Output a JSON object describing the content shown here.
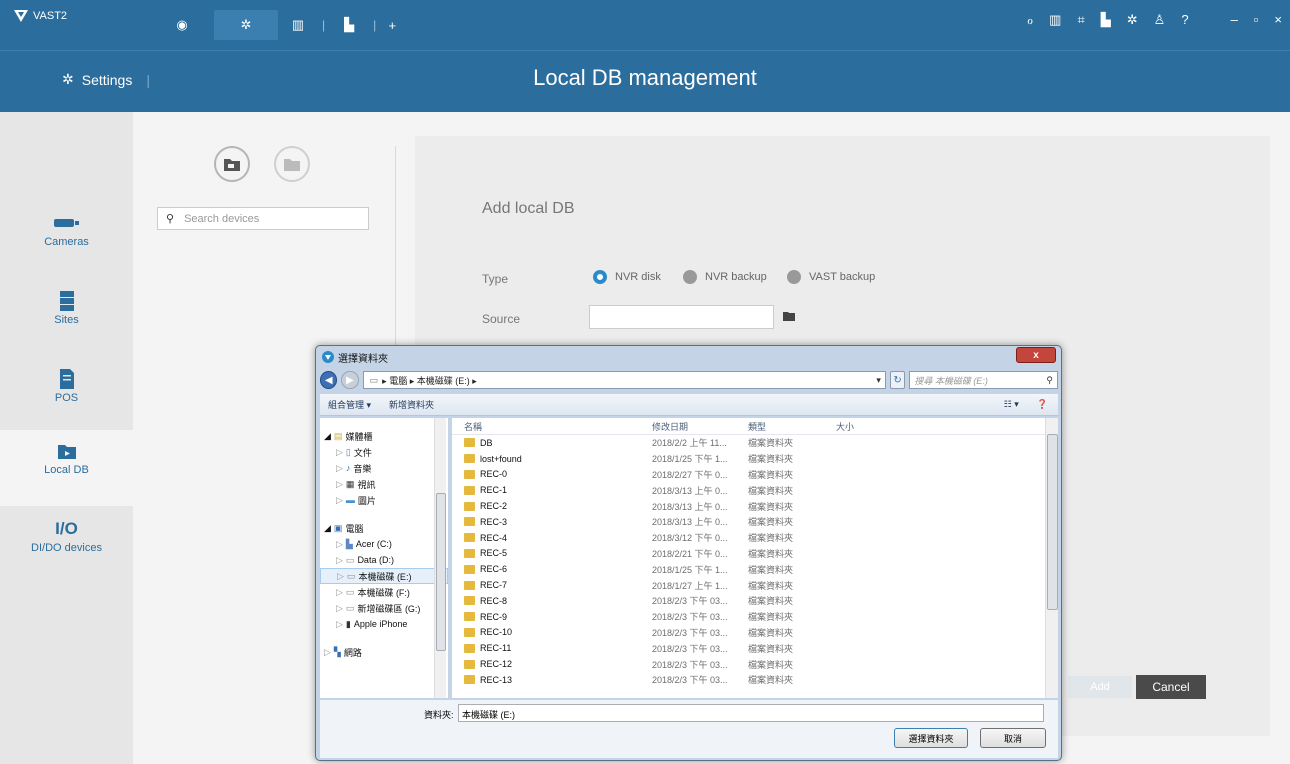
{
  "topbar": {
    "app_name": "VAST2",
    "right_icons": [
      "connect-icon",
      "map-icon",
      "chart-icon",
      "pos-icon",
      "settings-icon",
      "user-icon",
      "help-icon"
    ],
    "help": "?",
    "min": "–",
    "max": "▫",
    "close": "×"
  },
  "header": {
    "settings": "Settings",
    "title": "Local DB management"
  },
  "sidebar": {
    "items": [
      {
        "label": "Cameras"
      },
      {
        "label": "Sites"
      },
      {
        "label": "POS"
      },
      {
        "label": "Local DB"
      },
      {
        "label": "DI/DO devices",
        "icon_text": "I/O"
      }
    ]
  },
  "search": {
    "placeholder": "Search devices"
  },
  "form": {
    "title": "Add local DB",
    "type_label": "Type",
    "source_label": "Source",
    "options": [
      "NVR disk",
      "NVR backup",
      "VAST backup"
    ],
    "add": "Add",
    "cancel": "Cancel"
  },
  "dialog": {
    "title": "選擇資料夾",
    "path": "▸ 電腦 ▸ 本機磁碟 (E:) ▸",
    "search_placeholder": "搜尋 本機磁碟 (E:)",
    "toolbar": {
      "organize": "組合管理 ▾",
      "new_folder": "新增資料夾"
    },
    "tree": [
      {
        "label": "媒體櫃"
      },
      {
        "label": "文件"
      },
      {
        "label": "音樂"
      },
      {
        "label": "視訊"
      },
      {
        "label": "圖片"
      },
      {
        "label": "電腦"
      },
      {
        "label": "Acer (C:)"
      },
      {
        "label": "Data (D:)"
      },
      {
        "label": "本機磁碟 (E:)"
      },
      {
        "label": "本機磁碟 (F:)"
      },
      {
        "label": "新增磁碟區 (G:)"
      },
      {
        "label": "Apple iPhone"
      },
      {
        "label": "網路"
      }
    ],
    "columns": [
      "名稱",
      "修改日期",
      "類型",
      "大小"
    ],
    "files": [
      [
        "DB",
        "2018/2/2 上午 11...",
        "檔案資料夾"
      ],
      [
        "lost+found",
        "2018/1/25 下午 1...",
        "檔案資料夾"
      ],
      [
        "REC-0",
        "2018/2/27 下午 0...",
        "檔案資料夾"
      ],
      [
        "REC-1",
        "2018/3/13 上午 0...",
        "檔案資料夾"
      ],
      [
        "REC-2",
        "2018/3/13 上午 0...",
        "檔案資料夾"
      ],
      [
        "REC-3",
        "2018/3/13 上午 0...",
        "檔案資料夾"
      ],
      [
        "REC-4",
        "2018/3/12 下午 0...",
        "檔案資料夾"
      ],
      [
        "REC-5",
        "2018/2/21 下午 0...",
        "檔案資料夾"
      ],
      [
        "REC-6",
        "2018/1/25 下午 1...",
        "檔案資料夾"
      ],
      [
        "REC-7",
        "2018/1/27 上午 1...",
        "檔案資料夾"
      ],
      [
        "REC-8",
        "2018/2/3 下午 03...",
        "檔案資料夾"
      ],
      [
        "REC-9",
        "2018/2/3 下午 03...",
        "檔案資料夾"
      ],
      [
        "REC-10",
        "2018/2/3 下午 03...",
        "檔案資料夾"
      ],
      [
        "REC-11",
        "2018/2/3 下午 03...",
        "檔案資料夾"
      ],
      [
        "REC-12",
        "2018/2/3 下午 03...",
        "檔案資料夾"
      ],
      [
        "REC-13",
        "2018/2/3 下午 03...",
        "檔案資料夾"
      ]
    ],
    "folder_label": "資料夾:",
    "folder_value": "本機磁碟 (E:)",
    "ok": "選擇資料夾",
    "cancel": "取消"
  }
}
